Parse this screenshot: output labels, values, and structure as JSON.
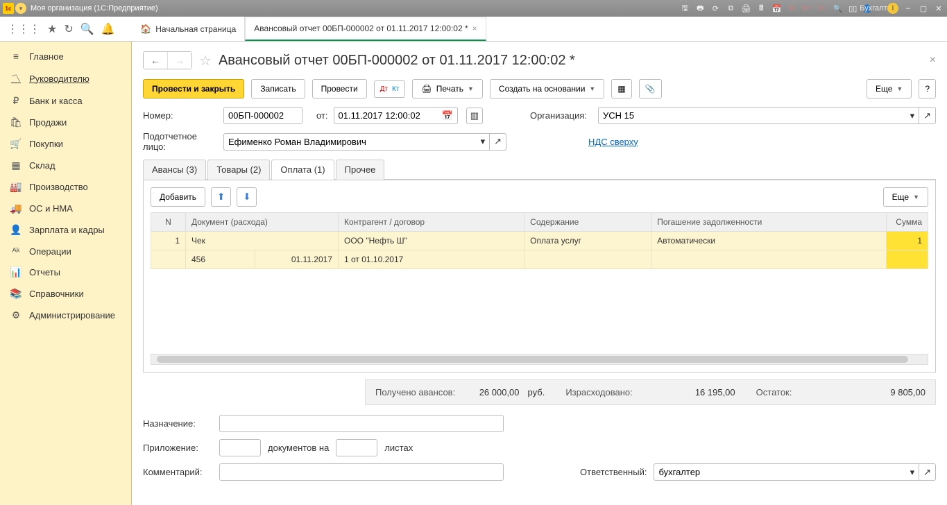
{
  "titlebar": {
    "app": "Моя организация  (1С:Предприятие)",
    "user": "Бухгалтер",
    "m_labels": [
      "M",
      "M+",
      "M-"
    ]
  },
  "toolbar": {
    "tab_home": "Начальная страница",
    "tab_doc": "Авансовый отчет 00БП-000002 от 01.11.2017 12:00:02 *"
  },
  "sidebar": [
    {
      "icon": "≡",
      "label": "Главное"
    },
    {
      "icon": "〽",
      "label": "Руководителю",
      "active": true
    },
    {
      "icon": "₽",
      "label": "Банк и касса"
    },
    {
      "icon": "🛍",
      "label": "Продажи"
    },
    {
      "icon": "🛒",
      "label": "Покупки"
    },
    {
      "icon": "▦",
      "label": "Склад"
    },
    {
      "icon": "🏭",
      "label": "Производство"
    },
    {
      "icon": "🚚",
      "label": "ОС и НМА"
    },
    {
      "icon": "👤",
      "label": "Зарплата и кадры"
    },
    {
      "icon": "ᴬᵏ",
      "label": "Операции"
    },
    {
      "icon": "📊",
      "label": "Отчеты"
    },
    {
      "icon": "📚",
      "label": "Справочники"
    },
    {
      "icon": "⚙",
      "label": "Администрирование"
    }
  ],
  "doc": {
    "title": "Авансовый отчет 00БП-000002 от 01.11.2017 12:00:02 *",
    "buttons": {
      "post_close": "Провести и закрыть",
      "save": "Записать",
      "post": "Провести",
      "print": "Печать",
      "create_based": "Создать на основании",
      "more": "Еще"
    },
    "labels": {
      "number": "Номер:",
      "from": "от:",
      "org": "Организация:",
      "person": "Подотчетное лицо:",
      "nds": "НДС сверху"
    },
    "values": {
      "number": "00БП-000002",
      "date": "01.11.2017 12:00:02",
      "org": "УСН 15",
      "person": "Ефименко Роман Владимирович"
    },
    "tabs": [
      {
        "label": "Авансы (3)"
      },
      {
        "label": "Товары (2)"
      },
      {
        "label": "Оплата (1)",
        "active": true
      },
      {
        "label": "Прочее"
      }
    ],
    "grid": {
      "add": "Добавить",
      "more": "Еще",
      "cols": [
        "N",
        "Документ (расхода)",
        "Контрагент / договор",
        "Содержание",
        "Погашение задолженности",
        "Сумма"
      ],
      "rows": [
        {
          "n": "1",
          "doc1": "Чек",
          "cp1": "ООО \"Нефть Ш\"",
          "content": "Оплата услуг",
          "repay": "Автоматически",
          "sum": "1"
        },
        {
          "doc2a": "456",
          "doc2b": "01.11.2017",
          "cp2": "1 от 01.10.2017"
        }
      ]
    },
    "totals": {
      "received_lbl": "Получено авансов:",
      "received_val": "26 000,00",
      "currency": "руб.",
      "spent_lbl": "Израсходовано:",
      "spent_val": "16 195,00",
      "rest_lbl": "Остаток:",
      "rest_val": "9 805,00"
    },
    "bottom": {
      "purpose_lbl": "Назначение:",
      "attach_lbl": "Приложение:",
      "docs_on": "документов на",
      "sheets": "листах",
      "comment_lbl": "Комментарий:",
      "responsible_lbl": "Ответственный:",
      "responsible_val": "бухгалтер"
    }
  }
}
